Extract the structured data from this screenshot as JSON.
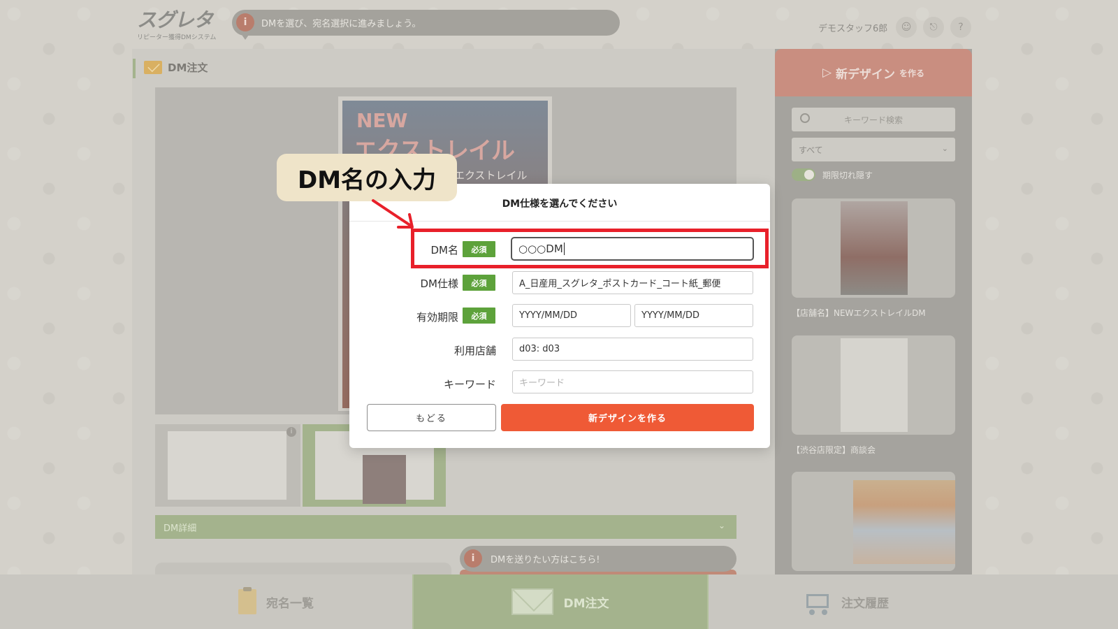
{
  "header": {
    "logo_main": "スグレタ",
    "logo_sub": "リピーター獲得DMシステム",
    "guide_icon": "i",
    "guide_text": "DMを選び、宛名選択に進みましょう。",
    "user_name": "デモスタッフ6郎",
    "icons": [
      "user-icon",
      "bell-icon",
      "help-icon"
    ]
  },
  "main": {
    "section_title": "DM注文",
    "poster": {
      "new": "NEW",
      "title": "エクストレイル",
      "subtitle": "エクストレイル"
    },
    "detail_bar": "DM詳細",
    "send_hint": "DMを送りたい方はこちら!"
  },
  "right_panel": {
    "new_design_main": "新デザイン",
    "new_design_suffix": "を作る",
    "search_placeholder": "キーワード検索",
    "filter_value": "すべて",
    "hide_expired_label": "期限切れ隠す",
    "templates": [
      {
        "label": "【店舗名】NEWエクストレイルDM"
      },
      {
        "label": "【渋谷店限定】商談会"
      }
    ]
  },
  "modal": {
    "title": "DM仕様を選んでください",
    "required_badge": "必須",
    "fields": {
      "dm_name": {
        "label": "DM名",
        "value": "○○○DM"
      },
      "dm_spec": {
        "label": "DM仕様",
        "value": "A_日産用_スグレタ_ポストカード_コート紙_郵便"
      },
      "expiry": {
        "label": "有効期限",
        "from_placeholder": "YYYY/MM/DD",
        "to_placeholder": "YYYY/MM/DD"
      },
      "store": {
        "label": "利用店舗",
        "value": "d03: d03"
      },
      "keyword": {
        "label": "キーワード",
        "placeholder": "キーワード"
      }
    },
    "back_button": "もどる",
    "create_button": "新デザインを作る"
  },
  "callout": {
    "text": "DM名の入力"
  },
  "bottom_nav": [
    {
      "label": "宛名一覧",
      "icon": "clipboard-icon"
    },
    {
      "label": "DM注文",
      "icon": "envelope-icon",
      "active": true
    },
    {
      "label": "注文履歴",
      "icon": "cart-icon"
    }
  ],
  "colors": {
    "accent_green": "#5da23b",
    "create_button": "#ef5a36",
    "highlight_red": "#e8202a"
  }
}
